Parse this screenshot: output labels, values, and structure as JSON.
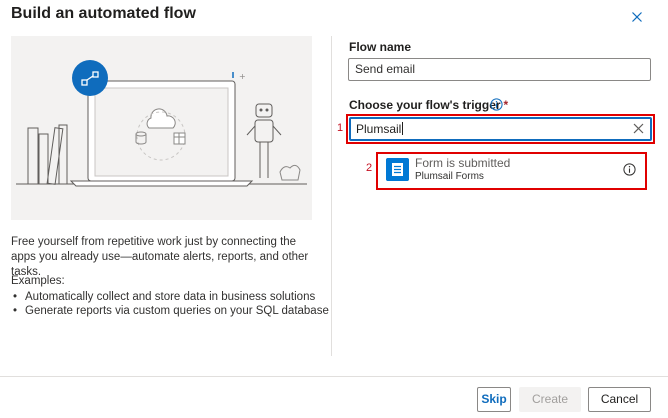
{
  "dialog": {
    "title": "Build an automated flow"
  },
  "intro": {
    "description": "Free yourself from repetitive work just by connecting the apps you already use—automate alerts, reports, and other tasks.",
    "examples_title": "Examples:",
    "examples": [
      "Automatically collect and store data in business solutions",
      "Generate reports via custom queries on your SQL database"
    ]
  },
  "form": {
    "flow_name_label": "Flow name",
    "flow_name_value": "Send email",
    "trigger_label": "Choose your flow's trigger",
    "required_mark": "*",
    "trigger_search_value": "Plumsail"
  },
  "annotations": {
    "first": "1",
    "second": "2"
  },
  "results": [
    {
      "name": "Form is submitted",
      "connector": "Plumsail Forms",
      "icon": "forms-icon"
    }
  ],
  "footer": {
    "skip_label": "Skip",
    "create_label": "Create",
    "cancel_label": "Cancel"
  },
  "colors": {
    "accent": "#0f6cbd",
    "highlight_box": "#e00000",
    "connector_icon": "#0078d4"
  }
}
